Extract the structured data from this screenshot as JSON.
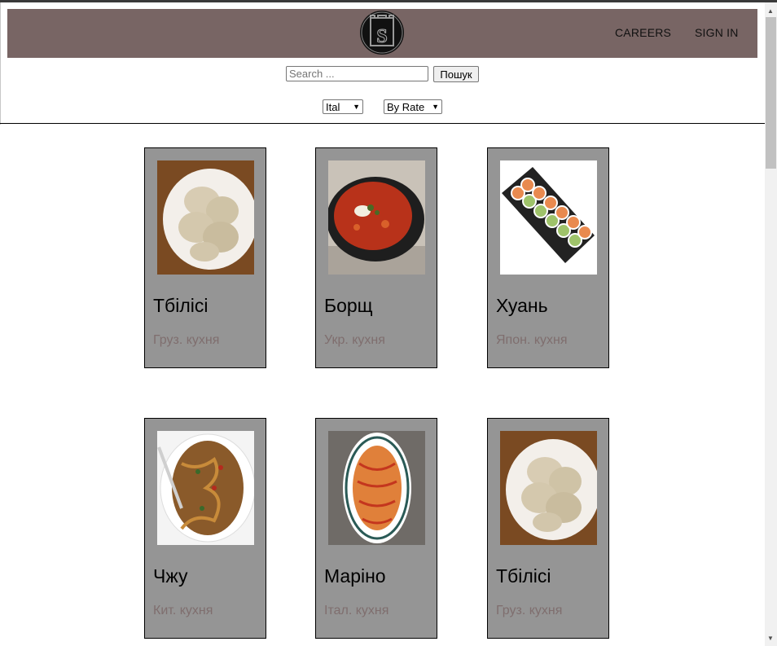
{
  "header": {
    "logo_text": "US",
    "nav": {
      "careers": "CAREERS",
      "sign_in": "SIGN IN"
    }
  },
  "search": {
    "placeholder": "Search ...",
    "button": "Пошук"
  },
  "filters": {
    "cuisine_selected": "Ital",
    "sort_selected": "By Rate"
  },
  "cards": [
    {
      "title": "Тбілісі",
      "subtitle": "Груз. кухня",
      "image": "khinkali-icon"
    },
    {
      "title": "Борщ",
      "subtitle": "Укр. кухня",
      "image": "borscht-icon"
    },
    {
      "title": "Хуань",
      "subtitle": "Япон. кухня",
      "image": "sushi-icon"
    },
    {
      "title": "Чжу",
      "subtitle": "Кит. кухня",
      "image": "noodles-icon"
    },
    {
      "title": "Маріно",
      "subtitle": "Італ. кухня",
      "image": "spaghetti-icon"
    },
    {
      "title": "Тбілісі",
      "subtitle": "Груз. кухня",
      "image": "khinkali-icon"
    }
  ],
  "colors": {
    "header_bg": "#786564",
    "card_bg": "#959595",
    "subtitle": "#7f6e6e"
  }
}
